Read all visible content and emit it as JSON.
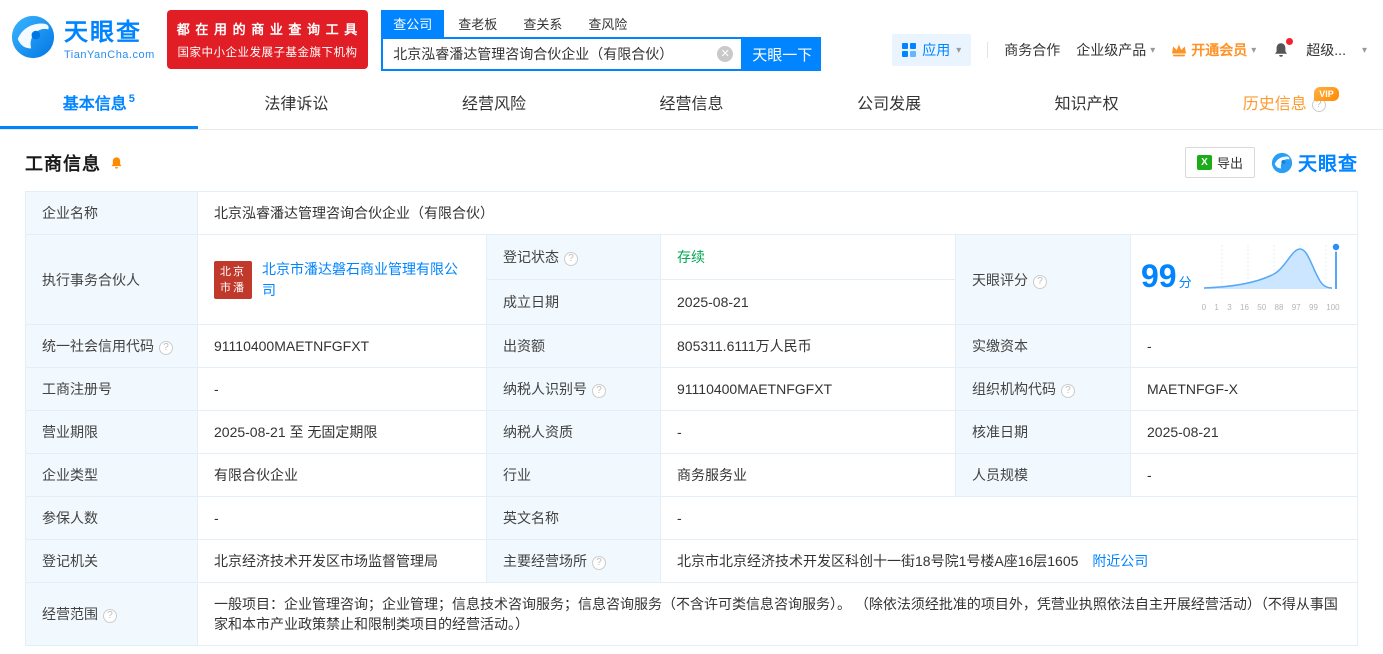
{
  "header": {
    "logo": {
      "title": "天眼查",
      "subtitle": "TianYanCha.com"
    },
    "badge": {
      "line1": "都 在 用 的 商 业 查 询 工 具",
      "line2": "国家中小企业发展子基金旗下机构"
    },
    "search": {
      "tabs": [
        {
          "label": "查公司"
        },
        {
          "label": "查老板"
        },
        {
          "label": "查关系"
        },
        {
          "label": "查风险"
        }
      ],
      "value": "北京泓睿潘达管理咨询合伙企业（有限合伙）",
      "button": "天眼一下"
    },
    "menu": {
      "apps": "应用",
      "cooperation": "商务合作",
      "enterprise": "企业级产品",
      "vip": "开通会员",
      "username": "超级..."
    }
  },
  "nav": {
    "tabs": [
      {
        "label": "基本信息",
        "count": "5"
      },
      {
        "label": "法律诉讼"
      },
      {
        "label": "经营风险"
      },
      {
        "label": "经营信息"
      },
      {
        "label": "公司发展"
      },
      {
        "label": "知识产权"
      },
      {
        "label": "历史信息"
      }
    ],
    "vip_badge": "VIP"
  },
  "section": {
    "title": "工商信息",
    "export_label": "导出",
    "watermark": "天眼查"
  },
  "table": {
    "company_name_label": "企业名称",
    "company_name": "北京泓睿潘达管理咨询合伙企业（有限合伙）",
    "partner_label": "执行事务合伙人",
    "partner_logo": "北京市潘",
    "partner_name": "北京市潘达磐石商业管理有限公司",
    "reg_status_label": "登记状态",
    "reg_status": "存续",
    "est_date_label": "成立日期",
    "est_date": "2025-08-21",
    "score_label": "天眼评分",
    "score": "99",
    "score_unit": "分",
    "score_ticks": [
      "0",
      "1",
      "3",
      "16",
      "50",
      "88",
      "97",
      "99",
      "100"
    ],
    "credit_code_label": "统一社会信用代码",
    "credit_code": "91110400MAETNFGFXT",
    "capital_label": "出资额",
    "capital": "805311.6111万人民币",
    "paid_capital_label": "实缴资本",
    "paid_capital": "-",
    "reg_number_label": "工商注册号",
    "reg_number": "-",
    "tax_id_label": "纳税人识别号",
    "tax_id": "91110400MAETNFGFXT",
    "org_code_label": "组织机构代码",
    "org_code": "MAETNFGF-X",
    "term_label": "营业期限",
    "term": "2025-08-21 至 无固定期限",
    "tax_qual_label": "纳税人资质",
    "tax_qual": "-",
    "approval_date_label": "核准日期",
    "approval_date": "2025-08-21",
    "company_type_label": "企业类型",
    "company_type": "有限合伙企业",
    "industry_label": "行业",
    "industry": "商务服务业",
    "staff_label": "人员规模",
    "staff": "-",
    "insured_label": "参保人数",
    "insured": "-",
    "english_name_label": "英文名称",
    "english_name": "-",
    "authority_label": "登记机关",
    "authority": "北京经济技术开发区市场监督管理局",
    "address_label": "主要经营场所",
    "address": "北京市北京经济技术开发区科创十一街18号院1号楼A座16层1605",
    "nearby_link": "附近公司",
    "scope_label": "经营范围",
    "scope": "一般项目：企业管理咨询；企业管理；信息技术咨询服务；信息咨询服务（不含许可类信息咨询服务）。 （除依法须经批准的项目外，凭营业执照依法自主开展经营活动）（不得从事国家和本市产业政策禁止和限制类项目的经营活动。）"
  }
}
